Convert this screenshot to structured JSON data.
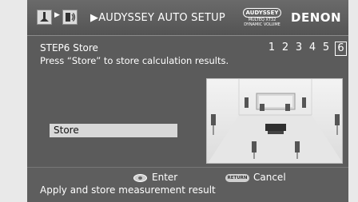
{
  "header": {
    "breadcrumb": "▶AUDYSSEY AUTO SETUP",
    "audyssey_badge": "AUDYSSEY",
    "audyssey_line1": "MULTEQ XT32",
    "audyssey_line2": "DYNAMIC VOLUME",
    "brand": "DENON",
    "icons": [
      "setup-icon",
      "audio-icon"
    ]
  },
  "step": {
    "title": "STEP6 Store",
    "description": "Press “Store” to store calculation results.",
    "numbers": [
      "1",
      "2",
      "3",
      "4",
      "5",
      "6"
    ],
    "current": "6"
  },
  "store_button": {
    "label": "Store"
  },
  "footer": {
    "enter_label": "Enter",
    "return_badge": "RETURN",
    "cancel_label": "Cancel",
    "status": "Apply and store measurement result"
  },
  "colors": {
    "panel": "#5b5b5b",
    "selected_button": "#d8d8d8",
    "text": "#ffffff"
  }
}
